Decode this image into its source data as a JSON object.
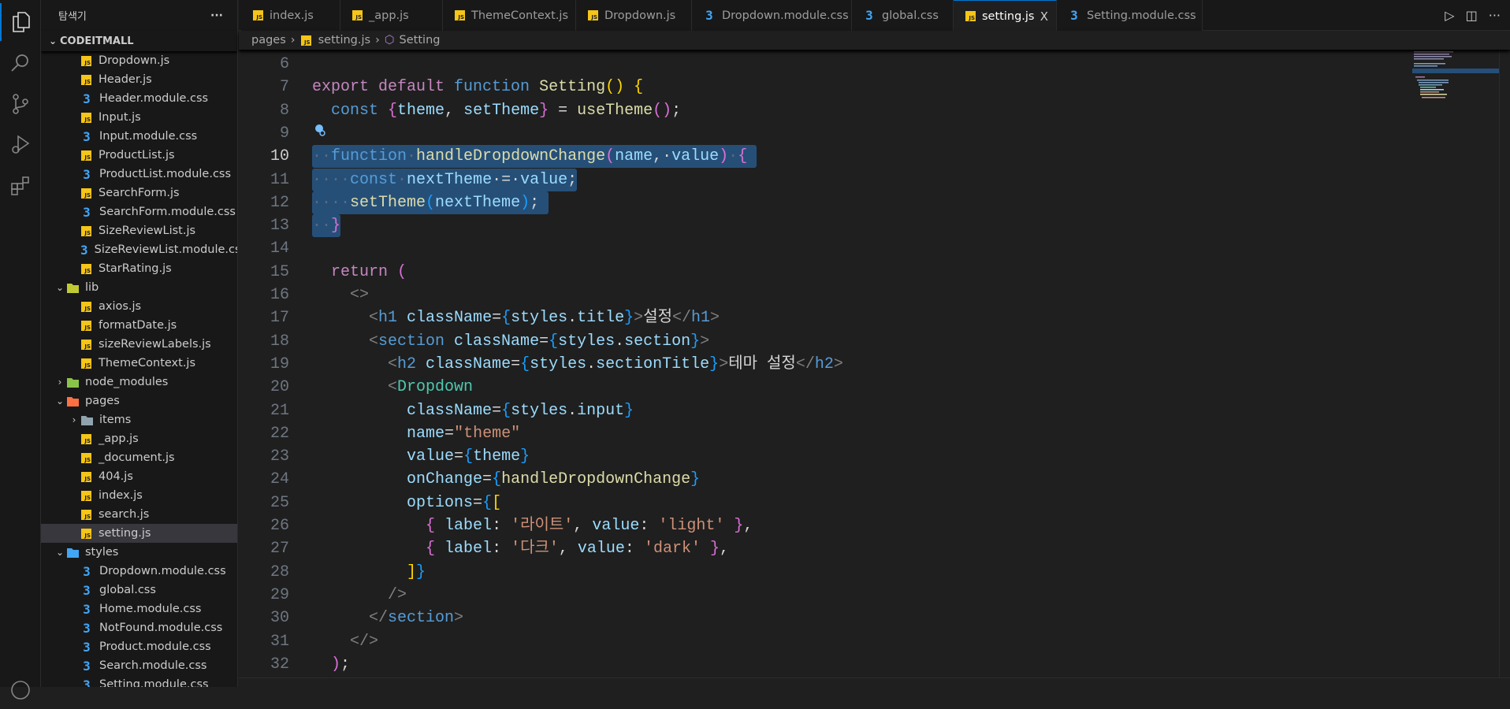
{
  "sidebar": {
    "title": "탐색기",
    "more": "···",
    "root": "CODEITMALL",
    "items": [
      {
        "label": "Dropdown.js",
        "type": "js",
        "depth": 2
      },
      {
        "label": "Header.js",
        "type": "js",
        "depth": 2
      },
      {
        "label": "Header.module.css",
        "type": "css",
        "depth": 2
      },
      {
        "label": "Input.js",
        "type": "js",
        "depth": 2
      },
      {
        "label": "Input.module.css",
        "type": "css",
        "depth": 2
      },
      {
        "label": "ProductList.js",
        "type": "js",
        "depth": 2
      },
      {
        "label": "ProductList.module.css",
        "type": "css",
        "depth": 2
      },
      {
        "label": "SearchForm.js",
        "type": "js",
        "depth": 2
      },
      {
        "label": "SearchForm.module.css",
        "type": "css",
        "depth": 2
      },
      {
        "label": "SizeReviewList.js",
        "type": "js",
        "depth": 2
      },
      {
        "label": "SizeReviewList.module.css",
        "type": "css",
        "depth": 2
      },
      {
        "label": "StarRating.js",
        "type": "js",
        "depth": 2
      },
      {
        "label": "lib",
        "type": "folder",
        "color": "#c0ca33",
        "depth": 1,
        "open": true
      },
      {
        "label": "axios.js",
        "type": "js",
        "depth": 2
      },
      {
        "label": "formatDate.js",
        "type": "js",
        "depth": 2
      },
      {
        "label": "sizeReviewLabels.js",
        "type": "js",
        "depth": 2
      },
      {
        "label": "ThemeContext.js",
        "type": "js",
        "depth": 2
      },
      {
        "label": "node_modules",
        "type": "folder",
        "color": "#8bc34a",
        "depth": 1,
        "open": false
      },
      {
        "label": "pages",
        "type": "folder",
        "color": "#ff7043",
        "depth": 1,
        "open": true
      },
      {
        "label": "items",
        "type": "folder",
        "color": "#90a4ae",
        "depth": 2,
        "open": false
      },
      {
        "label": "_app.js",
        "type": "js",
        "depth": 2
      },
      {
        "label": "_document.js",
        "type": "js",
        "depth": 2
      },
      {
        "label": "404.js",
        "type": "js",
        "depth": 2
      },
      {
        "label": "index.js",
        "type": "js",
        "depth": 2
      },
      {
        "label": "search.js",
        "type": "js",
        "depth": 2
      },
      {
        "label": "setting.js",
        "type": "js",
        "depth": 2,
        "selected": true
      },
      {
        "label": "styles",
        "type": "folder",
        "color": "#42a5f5",
        "depth": 1,
        "open": true
      },
      {
        "label": "Dropdown.module.css",
        "type": "css",
        "depth": 2
      },
      {
        "label": "global.css",
        "type": "css",
        "depth": 2
      },
      {
        "label": "Home.module.css",
        "type": "css",
        "depth": 2
      },
      {
        "label": "NotFound.module.css",
        "type": "css",
        "depth": 2
      },
      {
        "label": "Product.module.css",
        "type": "css",
        "depth": 2
      },
      {
        "label": "Search.module.css",
        "type": "css",
        "depth": 2
      },
      {
        "label": "Setting.module.css",
        "type": "css",
        "depth": 2
      }
    ]
  },
  "tabs": [
    {
      "label": "index.js",
      "type": "js"
    },
    {
      "label": "_app.js",
      "type": "js"
    },
    {
      "label": "ThemeContext.js",
      "type": "js"
    },
    {
      "label": "Dropdown.js",
      "type": "js"
    },
    {
      "label": "Dropdown.module.css",
      "type": "css"
    },
    {
      "label": "global.css",
      "type": "css"
    },
    {
      "label": "setting.js",
      "type": "js",
      "active": true
    },
    {
      "label": "Setting.module.css",
      "type": "css"
    }
  ],
  "tab_close": "X",
  "breadcrumb": {
    "folder": "pages",
    "file": "setting.js",
    "symbol": "Setting"
  },
  "code": [
    {
      "n": 6,
      "t": []
    },
    {
      "n": 7,
      "t": [
        [
          "export ",
          "kw"
        ],
        [
          "default ",
          "kw"
        ],
        [
          "function ",
          "st"
        ],
        [
          "Setting",
          "fn"
        ],
        [
          "(",
          "b1"
        ],
        [
          ")",
          "b1"
        ],
        [
          " ",
          "pn"
        ],
        [
          "{",
          "b1"
        ]
      ]
    },
    {
      "n": 8,
      "t": [
        [
          "  const ",
          "st"
        ],
        [
          "{",
          "b2"
        ],
        [
          "theme",
          "var"
        ],
        [
          ", ",
          "pn"
        ],
        [
          "setTheme",
          "var"
        ],
        [
          "}",
          "b2"
        ],
        [
          " = ",
          "pn"
        ],
        [
          "useTheme",
          "fn"
        ],
        [
          "(",
          "b2"
        ],
        [
          ")",
          "b2"
        ],
        [
          ";",
          "pn"
        ]
      ]
    },
    {
      "n": 9,
      "t": []
    },
    {
      "n": 10,
      "cur": true,
      "sel": true,
      "t": [
        [
          "··",
          "ws"
        ],
        [
          "function",
          "st"
        ],
        [
          "·",
          "ws"
        ],
        [
          "handleDropdownChange",
          "fn"
        ],
        [
          "(",
          "b2"
        ],
        [
          "name",
          "var"
        ],
        [
          ",·",
          "pn"
        ],
        [
          "value",
          "var"
        ],
        [
          ")",
          "b2"
        ],
        [
          "·",
          "ws"
        ],
        [
          "{",
          "b2"
        ],
        [
          " ",
          "pn"
        ]
      ]
    },
    {
      "n": 11,
      "sel": true,
      "t": [
        [
          "····",
          "ws"
        ],
        [
          "const",
          "st"
        ],
        [
          "·",
          "ws"
        ],
        [
          "nextTheme",
          "var"
        ],
        [
          "·=·",
          "pn"
        ],
        [
          "value",
          "var"
        ],
        [
          ";",
          "pn"
        ]
      ]
    },
    {
      "n": 12,
      "sel": true,
      "t": [
        [
          "····",
          "ws"
        ],
        [
          "setTheme",
          "fn"
        ],
        [
          "(",
          "b3"
        ],
        [
          "nextTheme",
          "var"
        ],
        [
          ")",
          "b3"
        ],
        [
          ";",
          "pn"
        ],
        [
          " ",
          "pn"
        ]
      ]
    },
    {
      "n": 13,
      "sel": true,
      "t": [
        [
          "··",
          "ws"
        ],
        [
          "}",
          "b2"
        ]
      ]
    },
    {
      "n": 14,
      "t": []
    },
    {
      "n": 15,
      "t": [
        [
          "  return ",
          "kw"
        ],
        [
          "(",
          "b2"
        ]
      ]
    },
    {
      "n": 16,
      "t": [
        [
          "    ",
          "pn"
        ],
        [
          "<>",
          "tag"
        ]
      ]
    },
    {
      "n": 17,
      "t": [
        [
          "      ",
          "pn"
        ],
        [
          "<",
          "tag"
        ],
        [
          "h1 ",
          "tn"
        ],
        [
          "className",
          "var"
        ],
        [
          "=",
          "pn"
        ],
        [
          "{",
          "b3"
        ],
        [
          "styles",
          "var"
        ],
        [
          ".",
          "pn"
        ],
        [
          "title",
          "var"
        ],
        [
          "}",
          "b3"
        ],
        [
          ">",
          "tag"
        ],
        [
          "설정",
          "txt"
        ],
        [
          "</",
          "tag"
        ],
        [
          "h1",
          "tn"
        ],
        [
          ">",
          "tag"
        ]
      ]
    },
    {
      "n": 18,
      "t": [
        [
          "      ",
          "pn"
        ],
        [
          "<",
          "tag"
        ],
        [
          "section ",
          "tn"
        ],
        [
          "className",
          "var"
        ],
        [
          "=",
          "pn"
        ],
        [
          "{",
          "b3"
        ],
        [
          "styles",
          "var"
        ],
        [
          ".",
          "pn"
        ],
        [
          "section",
          "var"
        ],
        [
          "}",
          "b3"
        ],
        [
          ">",
          "tag"
        ]
      ]
    },
    {
      "n": 19,
      "t": [
        [
          "        ",
          "pn"
        ],
        [
          "<",
          "tag"
        ],
        [
          "h2 ",
          "tn"
        ],
        [
          "className",
          "var"
        ],
        [
          "=",
          "pn"
        ],
        [
          "{",
          "b3"
        ],
        [
          "styles",
          "var"
        ],
        [
          ".",
          "pn"
        ],
        [
          "sectionTitle",
          "var"
        ],
        [
          "}",
          "b3"
        ],
        [
          ">",
          "tag"
        ],
        [
          "테마 설정",
          "txt"
        ],
        [
          "</",
          "tag"
        ],
        [
          "h2",
          "tn"
        ],
        [
          ">",
          "tag"
        ]
      ]
    },
    {
      "n": 20,
      "t": [
        [
          "        ",
          "pn"
        ],
        [
          "<",
          "tag"
        ],
        [
          "Dropdown",
          "cmp"
        ]
      ]
    },
    {
      "n": 21,
      "t": [
        [
          "          ",
          "pn"
        ],
        [
          "className",
          "var"
        ],
        [
          "=",
          "pn"
        ],
        [
          "{",
          "b3"
        ],
        [
          "styles",
          "var"
        ],
        [
          ".",
          "pn"
        ],
        [
          "input",
          "var"
        ],
        [
          "}",
          "b3"
        ]
      ]
    },
    {
      "n": 22,
      "t": [
        [
          "          ",
          "pn"
        ],
        [
          "name",
          "var"
        ],
        [
          "=",
          "pn"
        ],
        [
          "\"theme\"",
          "str"
        ]
      ]
    },
    {
      "n": 23,
      "t": [
        [
          "          ",
          "pn"
        ],
        [
          "value",
          "var"
        ],
        [
          "=",
          "pn"
        ],
        [
          "{",
          "b3"
        ],
        [
          "theme",
          "var"
        ],
        [
          "}",
          "b3"
        ]
      ]
    },
    {
      "n": 24,
      "t": [
        [
          "          ",
          "pn"
        ],
        [
          "onChange",
          "var"
        ],
        [
          "=",
          "pn"
        ],
        [
          "{",
          "b3"
        ],
        [
          "handleDropdownChange",
          "fn"
        ],
        [
          "}",
          "b3"
        ]
      ]
    },
    {
      "n": 25,
      "t": [
        [
          "          ",
          "pn"
        ],
        [
          "options",
          "var"
        ],
        [
          "=",
          "pn"
        ],
        [
          "{",
          "b3"
        ],
        [
          "[",
          "b1"
        ]
      ]
    },
    {
      "n": 26,
      "t": [
        [
          "            ",
          "pn"
        ],
        [
          "{",
          "b2"
        ],
        [
          " label",
          "var"
        ],
        [
          ": ",
          "pn"
        ],
        [
          "'라이트'",
          "str"
        ],
        [
          ", ",
          "pn"
        ],
        [
          "value",
          "var"
        ],
        [
          ": ",
          "pn"
        ],
        [
          "'light'",
          "str"
        ],
        [
          " ",
          "pn"
        ],
        [
          "}",
          "b2"
        ],
        [
          ",",
          "pn"
        ]
      ]
    },
    {
      "n": 27,
      "t": [
        [
          "            ",
          "pn"
        ],
        [
          "{",
          "b2"
        ],
        [
          " label",
          "var"
        ],
        [
          ": ",
          "pn"
        ],
        [
          "'다크'",
          "str"
        ],
        [
          ", ",
          "pn"
        ],
        [
          "value",
          "var"
        ],
        [
          ": ",
          "pn"
        ],
        [
          "'dark'",
          "str"
        ],
        [
          " ",
          "pn"
        ],
        [
          "}",
          "b2"
        ],
        [
          ",",
          "pn"
        ]
      ]
    },
    {
      "n": 28,
      "t": [
        [
          "          ",
          "pn"
        ],
        [
          "]",
          "b1"
        ],
        [
          "}",
          "b3"
        ]
      ]
    },
    {
      "n": 29,
      "t": [
        [
          "        ",
          "pn"
        ],
        [
          "/>",
          "tag"
        ]
      ]
    },
    {
      "n": 30,
      "t": [
        [
          "      ",
          "pn"
        ],
        [
          "</",
          "tag"
        ],
        [
          "section",
          "tn"
        ],
        [
          ">",
          "tag"
        ]
      ]
    },
    {
      "n": 31,
      "t": [
        [
          "    ",
          "pn"
        ],
        [
          "</>",
          "tag"
        ]
      ]
    },
    {
      "n": 32,
      "t": [
        [
          "  ",
          "pn"
        ],
        [
          ")",
          "b2"
        ],
        [
          ";",
          "pn"
        ]
      ]
    }
  ]
}
